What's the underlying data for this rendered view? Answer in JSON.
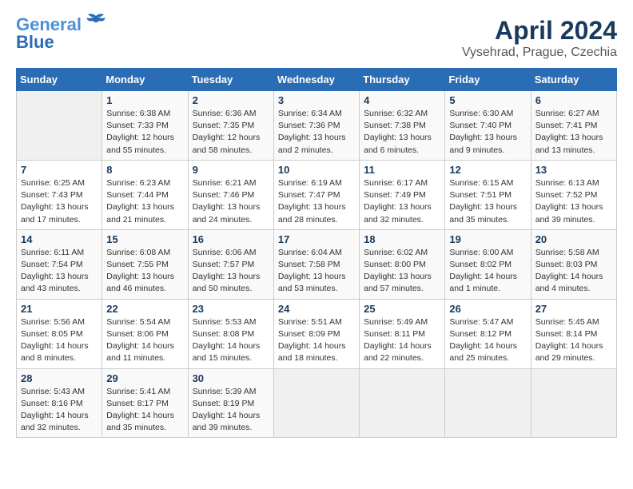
{
  "header": {
    "logo_line1": "General",
    "logo_line2": "Blue",
    "month_year": "April 2024",
    "location": "Vysehrad, Prague, Czechia"
  },
  "days_of_week": [
    "Sunday",
    "Monday",
    "Tuesday",
    "Wednesday",
    "Thursday",
    "Friday",
    "Saturday"
  ],
  "weeks": [
    [
      {
        "day": "",
        "info": ""
      },
      {
        "day": "1",
        "info": "Sunrise: 6:38 AM\nSunset: 7:33 PM\nDaylight: 12 hours\nand 55 minutes."
      },
      {
        "day": "2",
        "info": "Sunrise: 6:36 AM\nSunset: 7:35 PM\nDaylight: 12 hours\nand 58 minutes."
      },
      {
        "day": "3",
        "info": "Sunrise: 6:34 AM\nSunset: 7:36 PM\nDaylight: 13 hours\nand 2 minutes."
      },
      {
        "day": "4",
        "info": "Sunrise: 6:32 AM\nSunset: 7:38 PM\nDaylight: 13 hours\nand 6 minutes."
      },
      {
        "day": "5",
        "info": "Sunrise: 6:30 AM\nSunset: 7:40 PM\nDaylight: 13 hours\nand 9 minutes."
      },
      {
        "day": "6",
        "info": "Sunrise: 6:27 AM\nSunset: 7:41 PM\nDaylight: 13 hours\nand 13 minutes."
      }
    ],
    [
      {
        "day": "7",
        "info": "Sunrise: 6:25 AM\nSunset: 7:43 PM\nDaylight: 13 hours\nand 17 minutes."
      },
      {
        "day": "8",
        "info": "Sunrise: 6:23 AM\nSunset: 7:44 PM\nDaylight: 13 hours\nand 21 minutes."
      },
      {
        "day": "9",
        "info": "Sunrise: 6:21 AM\nSunset: 7:46 PM\nDaylight: 13 hours\nand 24 minutes."
      },
      {
        "day": "10",
        "info": "Sunrise: 6:19 AM\nSunset: 7:47 PM\nDaylight: 13 hours\nand 28 minutes."
      },
      {
        "day": "11",
        "info": "Sunrise: 6:17 AM\nSunset: 7:49 PM\nDaylight: 13 hours\nand 32 minutes."
      },
      {
        "day": "12",
        "info": "Sunrise: 6:15 AM\nSunset: 7:51 PM\nDaylight: 13 hours\nand 35 minutes."
      },
      {
        "day": "13",
        "info": "Sunrise: 6:13 AM\nSunset: 7:52 PM\nDaylight: 13 hours\nand 39 minutes."
      }
    ],
    [
      {
        "day": "14",
        "info": "Sunrise: 6:11 AM\nSunset: 7:54 PM\nDaylight: 13 hours\nand 43 minutes."
      },
      {
        "day": "15",
        "info": "Sunrise: 6:08 AM\nSunset: 7:55 PM\nDaylight: 13 hours\nand 46 minutes."
      },
      {
        "day": "16",
        "info": "Sunrise: 6:06 AM\nSunset: 7:57 PM\nDaylight: 13 hours\nand 50 minutes."
      },
      {
        "day": "17",
        "info": "Sunrise: 6:04 AM\nSunset: 7:58 PM\nDaylight: 13 hours\nand 53 minutes."
      },
      {
        "day": "18",
        "info": "Sunrise: 6:02 AM\nSunset: 8:00 PM\nDaylight: 13 hours\nand 57 minutes."
      },
      {
        "day": "19",
        "info": "Sunrise: 6:00 AM\nSunset: 8:02 PM\nDaylight: 14 hours\nand 1 minute."
      },
      {
        "day": "20",
        "info": "Sunrise: 5:58 AM\nSunset: 8:03 PM\nDaylight: 14 hours\nand 4 minutes."
      }
    ],
    [
      {
        "day": "21",
        "info": "Sunrise: 5:56 AM\nSunset: 8:05 PM\nDaylight: 14 hours\nand 8 minutes."
      },
      {
        "day": "22",
        "info": "Sunrise: 5:54 AM\nSunset: 8:06 PM\nDaylight: 14 hours\nand 11 minutes."
      },
      {
        "day": "23",
        "info": "Sunrise: 5:53 AM\nSunset: 8:08 PM\nDaylight: 14 hours\nand 15 minutes."
      },
      {
        "day": "24",
        "info": "Sunrise: 5:51 AM\nSunset: 8:09 PM\nDaylight: 14 hours\nand 18 minutes."
      },
      {
        "day": "25",
        "info": "Sunrise: 5:49 AM\nSunset: 8:11 PM\nDaylight: 14 hours\nand 22 minutes."
      },
      {
        "day": "26",
        "info": "Sunrise: 5:47 AM\nSunset: 8:12 PM\nDaylight: 14 hours\nand 25 minutes."
      },
      {
        "day": "27",
        "info": "Sunrise: 5:45 AM\nSunset: 8:14 PM\nDaylight: 14 hours\nand 29 minutes."
      }
    ],
    [
      {
        "day": "28",
        "info": "Sunrise: 5:43 AM\nSunset: 8:16 PM\nDaylight: 14 hours\nand 32 minutes."
      },
      {
        "day": "29",
        "info": "Sunrise: 5:41 AM\nSunset: 8:17 PM\nDaylight: 14 hours\nand 35 minutes."
      },
      {
        "day": "30",
        "info": "Sunrise: 5:39 AM\nSunset: 8:19 PM\nDaylight: 14 hours\nand 39 minutes."
      },
      {
        "day": "",
        "info": ""
      },
      {
        "day": "",
        "info": ""
      },
      {
        "day": "",
        "info": ""
      },
      {
        "day": "",
        "info": ""
      }
    ]
  ]
}
